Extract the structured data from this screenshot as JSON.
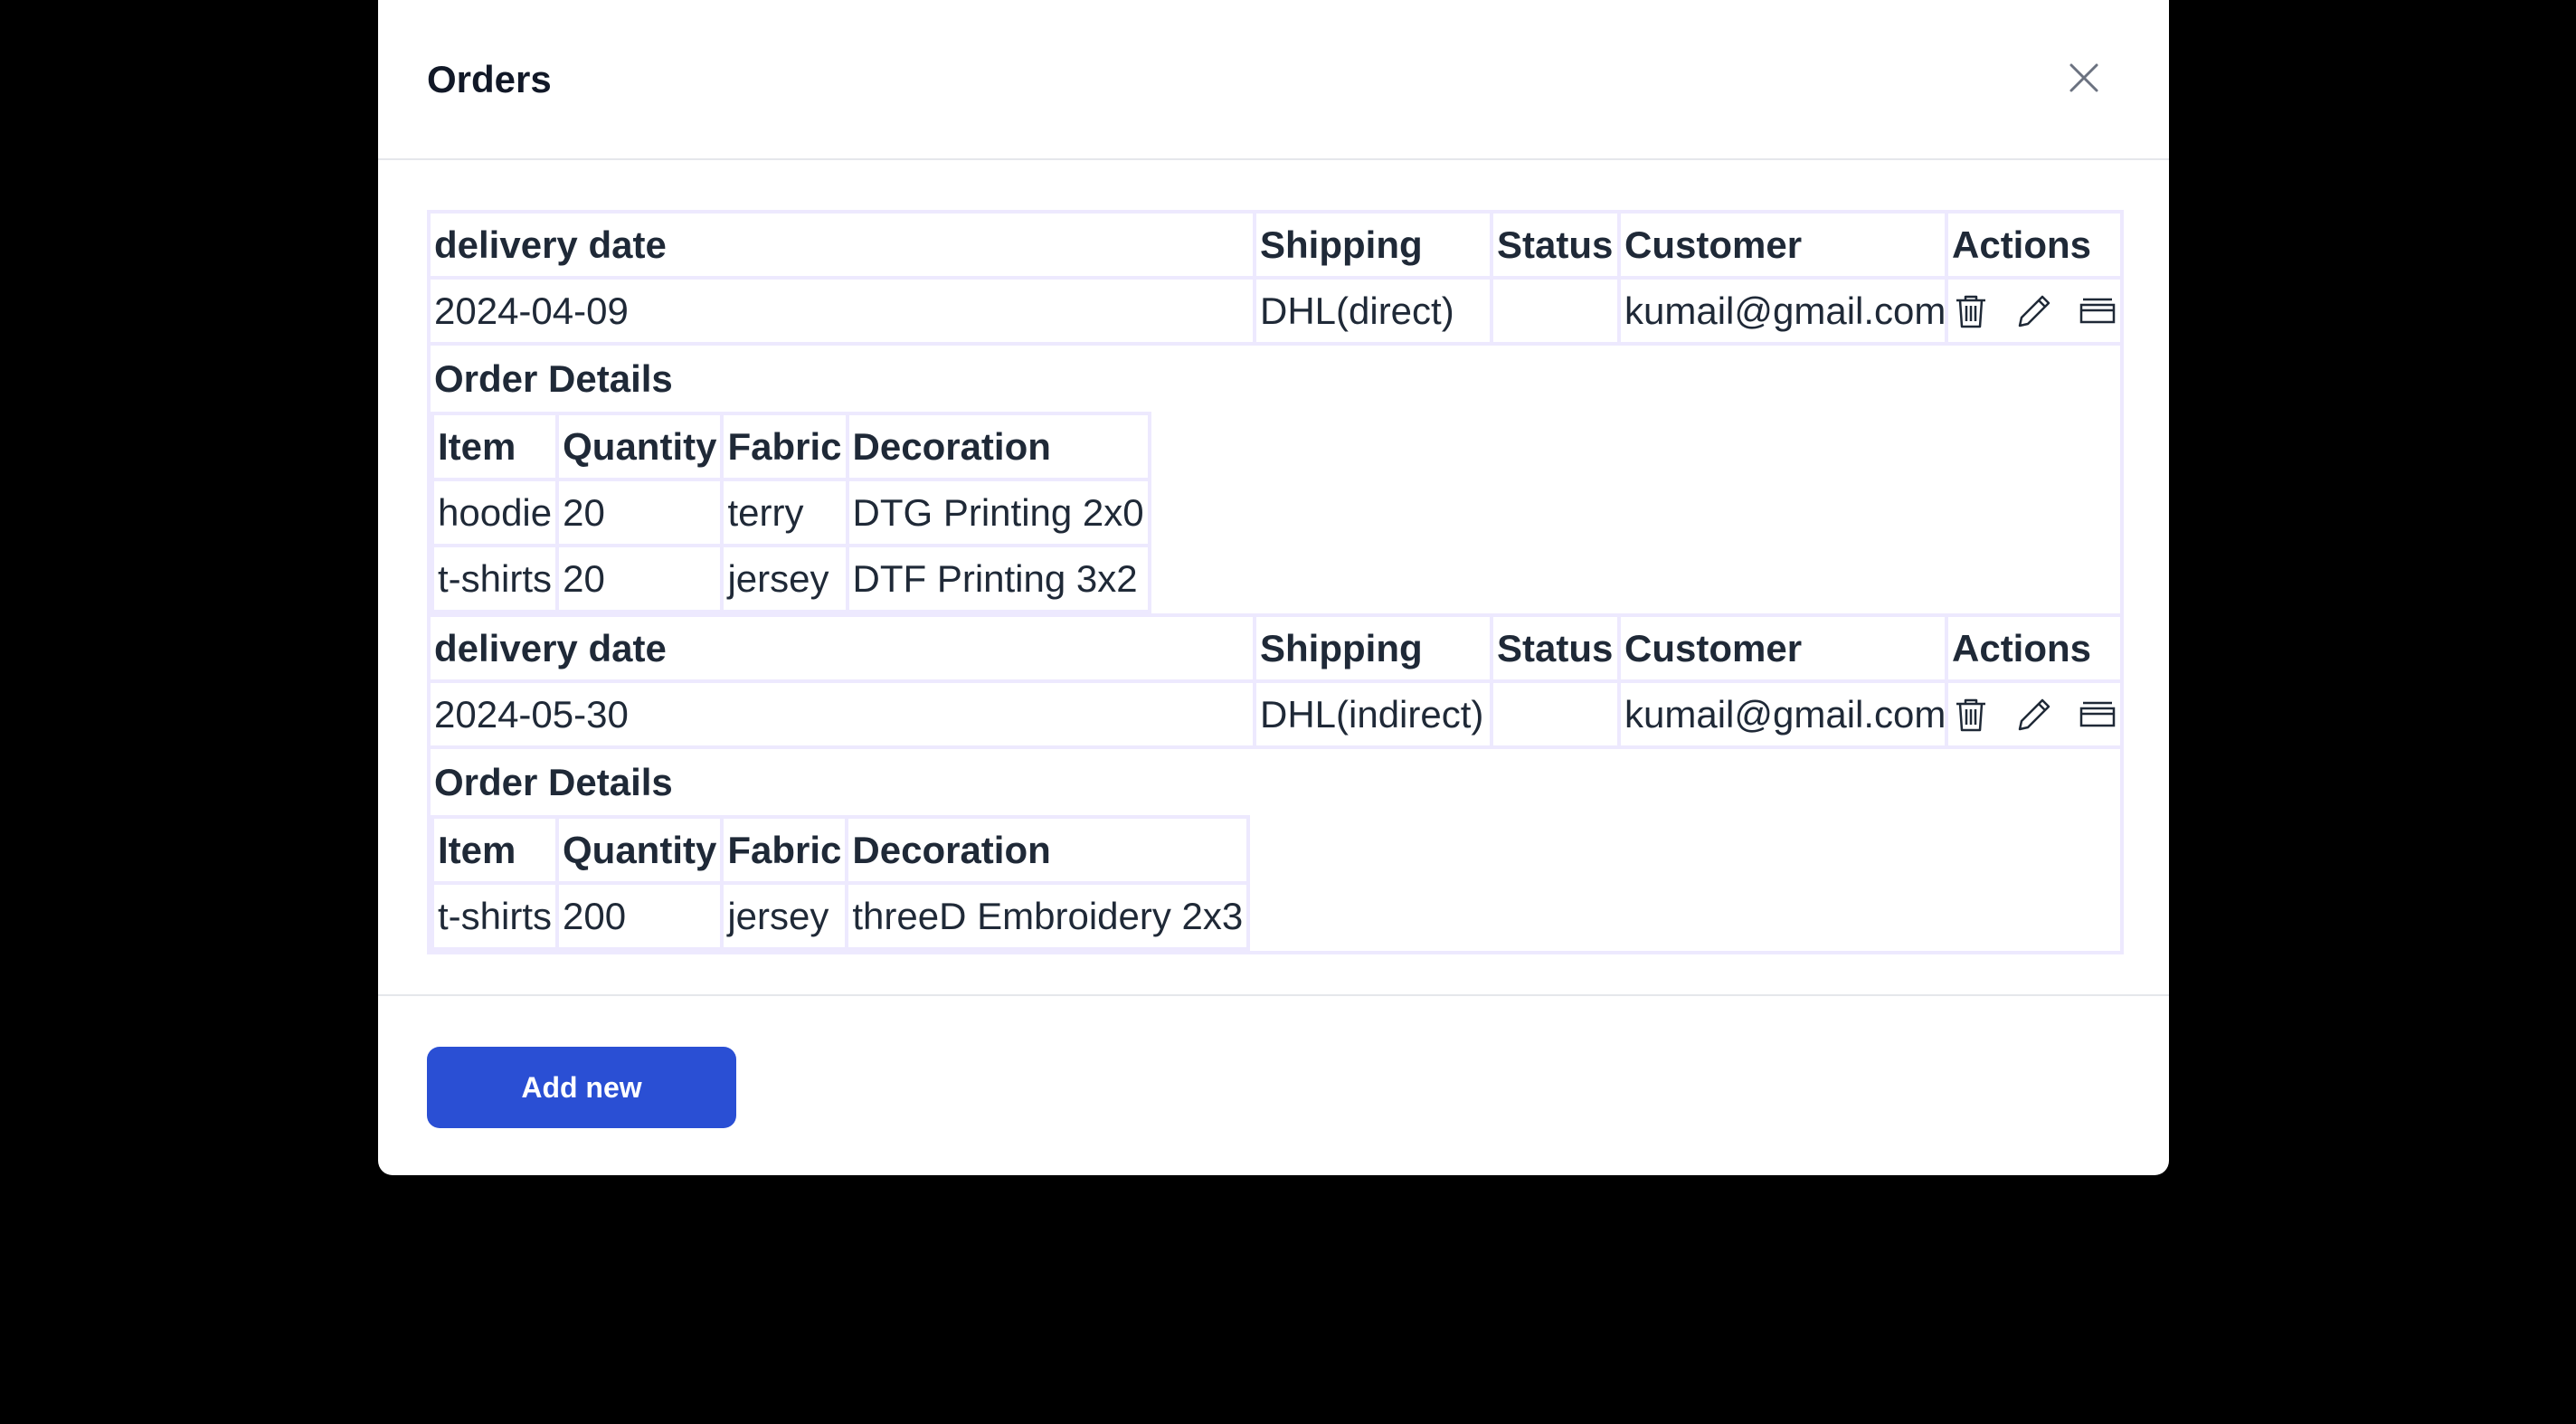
{
  "modal": {
    "title": "Orders",
    "close_icon": "close-icon"
  },
  "table": {
    "headers": {
      "delivery_date": "delivery date",
      "shipping": "Shipping",
      "status": "Status",
      "customer": "Customer",
      "actions": "Actions"
    },
    "details_title": "Order Details",
    "details_headers": {
      "item": "Item",
      "quantity": "Quantity",
      "fabric": "Fabric",
      "decoration": "Decoration"
    },
    "orders": [
      {
        "delivery_date": "2024-04-09",
        "shipping": "DHL(direct)",
        "status": "",
        "customer": "kumail@gmail.com",
        "details": [
          {
            "item": "hoodie",
            "quantity": "20",
            "fabric": "terry",
            "decoration": "DTG Printing 2x0"
          },
          {
            "item": "t-shirts",
            "quantity": "20",
            "fabric": "jersey",
            "decoration": "DTF Printing 3x2"
          }
        ]
      },
      {
        "delivery_date": "2024-05-30",
        "shipping": "DHL(indirect)",
        "status": "",
        "customer": "kumail@gmail.com",
        "details": [
          {
            "item": "t-shirts",
            "quantity": "200",
            "fabric": "jersey",
            "decoration": "threeD Embroidery 2x3"
          }
        ]
      }
    ],
    "action_icons": [
      "trash-icon",
      "pencil-icon",
      "details-icon"
    ]
  },
  "footer": {
    "add_label": "Add new"
  },
  "colors": {
    "backdrop": "#000000",
    "primary_button": "#2a4fd4",
    "table_border": "#ede9fe"
  }
}
